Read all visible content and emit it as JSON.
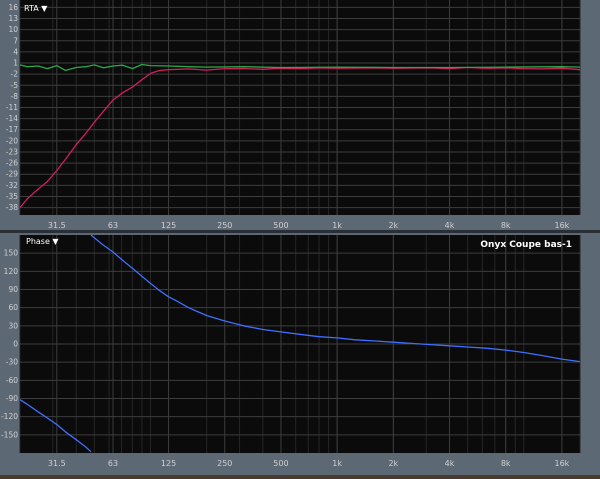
{
  "rta_panel": {
    "dropdown_label": "RTA ▼"
  },
  "phase_panel": {
    "dropdown_label": "Phase ▼",
    "measurement_name": "Onyx Coupe bas-1"
  },
  "colors": {
    "plot_background": "#0b0b0b",
    "minor_grid": "#262626",
    "major_grid": "#3d3d3d",
    "tick_text": "#d0d0d0",
    "axis_band": "#5d6875",
    "magnitude_trace_1": "#d0205a",
    "magnitude_trace_2": "#2aa84a",
    "phase_trace": "#3f6fff"
  },
  "chart_data": [
    {
      "type": "line",
      "title": "",
      "xscale": "log",
      "xlim": [
        20,
        20000
      ],
      "ylim": [
        -40,
        18
      ],
      "grid": true,
      "x_tick_labels": [
        {
          "value": 31.5,
          "label": "31.5"
        },
        {
          "value": 63,
          "label": "63"
        },
        {
          "value": 125,
          "label": "125"
        },
        {
          "value": 250,
          "label": "250"
        },
        {
          "value": 500,
          "label": "500"
        },
        {
          "value": 1000,
          "label": "1k"
        },
        {
          "value": 2000,
          "label": "2k"
        },
        {
          "value": 4000,
          "label": "4k"
        },
        {
          "value": 8000,
          "label": "8k"
        },
        {
          "value": 16000,
          "label": "16k"
        }
      ],
      "y_tick_labels": [
        16,
        13,
        10,
        7,
        4,
        1,
        -2,
        -5,
        -8,
        -11,
        -14,
        -17,
        -20,
        -23,
        -26,
        -29,
        -32,
        -35,
        -38
      ],
      "series": [
        {
          "color": "#d0205a",
          "points": [
            [
              20,
              -38
            ],
            [
              22,
              -35.5
            ],
            [
              25,
              -33
            ],
            [
              28,
              -31
            ],
            [
              31.5,
              -28
            ],
            [
              35,
              -25
            ],
            [
              40,
              -21
            ],
            [
              45,
              -18
            ],
            [
              50,
              -15
            ],
            [
              56,
              -12
            ],
            [
              63,
              -9
            ],
            [
              71,
              -7
            ],
            [
              80,
              -5.5
            ],
            [
              90,
              -3.5
            ],
            [
              100,
              -1.8
            ],
            [
              112,
              -1
            ],
            [
              125,
              -0.8
            ],
            [
              160,
              -0.6
            ],
            [
              200,
              -0.9
            ],
            [
              250,
              -0.5
            ],
            [
              315,
              -0.5
            ],
            [
              400,
              -0.7
            ],
            [
              500,
              -0.4
            ],
            [
              630,
              -0.5
            ],
            [
              800,
              -0.3
            ],
            [
              1000,
              -0.4
            ],
            [
              1600,
              -0.3
            ],
            [
              2000,
              -0.4
            ],
            [
              3150,
              -0.3
            ],
            [
              4000,
              -0.5
            ],
            [
              5000,
              -0.2
            ],
            [
              6300,
              -0.4
            ],
            [
              8000,
              -0.3
            ],
            [
              10000,
              -0.5
            ],
            [
              12500,
              -0.6
            ],
            [
              16000,
              -0.4
            ],
            [
              20000,
              -0.8
            ]
          ]
        },
        {
          "color": "#2aa84a",
          "points": [
            [
              20,
              0.5
            ],
            [
              22,
              0
            ],
            [
              25,
              0.2
            ],
            [
              28,
              -0.5
            ],
            [
              31.5,
              0.3
            ],
            [
              35,
              -1
            ],
            [
              40,
              -0.2
            ],
            [
              45,
              0
            ],
            [
              50,
              0.5
            ],
            [
              56,
              -0.3
            ],
            [
              63,
              0.2
            ],
            [
              71,
              0.4
            ],
            [
              80,
              -0.5
            ],
            [
              90,
              0.6
            ],
            [
              100,
              0.3
            ],
            [
              125,
              0.2
            ],
            [
              160,
              0
            ],
            [
              200,
              -0.1
            ],
            [
              315,
              0
            ],
            [
              500,
              -0.2
            ],
            [
              1000,
              -0.1
            ],
            [
              2000,
              -0.2
            ],
            [
              4000,
              -0.2
            ],
            [
              8000,
              -0.1
            ],
            [
              16000,
              0
            ],
            [
              20000,
              -0.1
            ]
          ]
        }
      ]
    },
    {
      "type": "line",
      "title": "Onyx Coupe bas-1",
      "xscale": "log",
      "xlim": [
        20,
        20000
      ],
      "ylim": [
        -180,
        180
      ],
      "grid": true,
      "x_tick_labels": [
        {
          "value": 31.5,
          "label": "31.5"
        },
        {
          "value": 63,
          "label": "63"
        },
        {
          "value": 125,
          "label": "125"
        },
        {
          "value": 250,
          "label": "250"
        },
        {
          "value": 500,
          "label": "500"
        },
        {
          "value": 1000,
          "label": "1k"
        },
        {
          "value": 2000,
          "label": "2k"
        },
        {
          "value": 4000,
          "label": "4k"
        },
        {
          "value": 8000,
          "label": "8k"
        },
        {
          "value": 16000,
          "label": "16k"
        }
      ],
      "y_tick_labels": [
        150,
        120,
        90,
        60,
        30,
        0,
        -30,
        -60,
        -90,
        -120,
        -150
      ],
      "series": [
        {
          "color": "#3f6fff",
          "points": [
            [
              48,
              180
            ],
            [
              55,
              165
            ],
            [
              63,
              152
            ],
            [
              71,
              138
            ],
            [
              80,
              125
            ],
            [
              90,
              112
            ],
            [
              100,
              100
            ],
            [
              112,
              88
            ],
            [
              125,
              78
            ],
            [
              140,
              70
            ],
            [
              160,
              60
            ],
            [
              180,
              53
            ],
            [
              200,
              47
            ],
            [
              250,
              38
            ],
            [
              315,
              30
            ],
            [
              400,
              24
            ],
            [
              500,
              20
            ],
            [
              630,
              16
            ],
            [
              800,
              12
            ],
            [
              1000,
              10
            ],
            [
              1250,
              7
            ],
            [
              1600,
              5
            ],
            [
              2000,
              3
            ],
            [
              2500,
              1
            ],
            [
              3150,
              -1
            ],
            [
              4000,
              -3
            ],
            [
              5000,
              -5
            ],
            [
              6300,
              -7
            ],
            [
              8000,
              -10
            ],
            [
              10000,
              -14
            ],
            [
              12500,
              -19
            ],
            [
              16000,
              -25
            ],
            [
              20000,
              -29
            ]
          ]
        },
        {
          "color": "#3f6fff",
          "points": [
            [
              20,
              -92
            ],
            [
              22,
              -100
            ],
            [
              25,
              -112
            ],
            [
              28,
              -122
            ],
            [
              31.5,
              -133
            ],
            [
              35,
              -145
            ],
            [
              40,
              -158
            ],
            [
              45,
              -170
            ],
            [
              48,
              -178
            ]
          ]
        }
      ]
    }
  ]
}
